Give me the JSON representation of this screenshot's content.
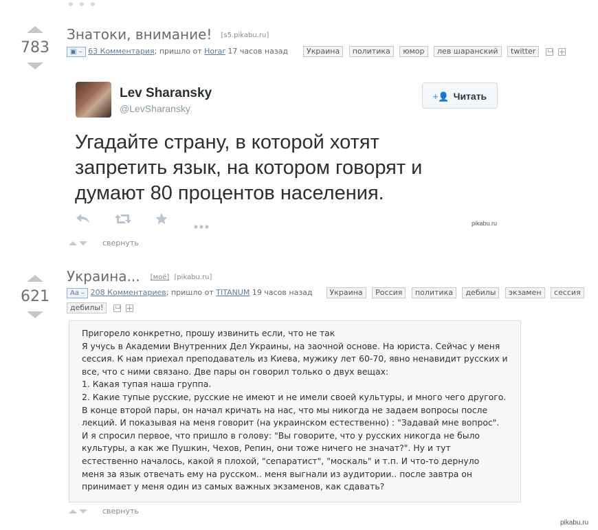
{
  "post1": {
    "score": "783",
    "title": "Знатоки, внимание!",
    "source": "[s5.pikabu.ru]",
    "badge": "▣ –",
    "comments": "63 Комментария",
    "from_prefix": "; пришло от ",
    "author": "Horar",
    "time": "17 часов назад",
    "tags": [
      "Украина",
      "политика",
      "юмор",
      "лев шаранский",
      "twitter"
    ],
    "tweet": {
      "name": "Lev Sharansky",
      "handle": "@LevSharansky",
      "follow": "Читать",
      "lines": [
        "Угадайте страну, в которой хотят",
        "запретить язык, на котором говорят и",
        "думают 80 процентов населения."
      ],
      "watermark": "pikabu.ru"
    },
    "collapse": "свернуть"
  },
  "post2": {
    "score": "621",
    "title": "Украина...",
    "source_mine": "[моё]",
    "source": "[pikabu.ru]",
    "badge": "Aa –",
    "comments": "208 Комментариев",
    "from_prefix": "; пришло от ",
    "author": "TITANUM",
    "time": "19 часов назад",
    "tags": [
      "Украина",
      "Россия",
      "политика",
      "дебилы",
      "экзамен",
      "сессия"
    ],
    "tags_row2": [
      "дебилы!"
    ],
    "story": [
      "Пригорело конкретно, прошу извинить если, что не так",
      "Я учусь в Академии Внутренних Дел Украины, на заочной основе. На юриста. Сейчас у меня",
      "сессия. К нам приехал преподаватель из Киева, мужику лет 60-70, явно ненавидит русских и",
      "все, что с ними связано. Две пары он говорил только о двух вещах:",
      "1. Какая тупая наша группа.",
      "2. Какие тупые русские, русские не имеют и не имели своей культуры, и много чего другого.",
      "В конце второй пары, он начал кричать на нас, что мы никогда не задаем вопросы после",
      "лекций. И показывая на меня говорит (на украинском естественно) : \"Задавай мне вопрос\".",
      "И я спросил первое, что пришло в голову: \"Вы говорите, что у русских никогда не было",
      "культуры, а как же Пушкин, Чехов, Репин, они тоже ничего не значат?\". Ну и тут",
      "естественно началось, какой я плохой, \"сепаратист\", \"москаль\" и т.п. И что-то дернуло",
      "меня за язык отвечать ему на русском.. меня выгнали из аудитории.. после завтра он",
      "принимает у меня один из самых важных экзаменов, как сдавать?"
    ],
    "collapse": "свернуть",
    "watermark": "pikabu.ru"
  },
  "icons": {
    "vote_up": "triangle-up-icon",
    "vote_down": "triangle-down-icon",
    "reply": "reply-icon",
    "retweet": "retweet-icon",
    "favorite": "star-icon",
    "more": "more-icon",
    "follow": "add-user-icon",
    "save": "save-icon",
    "add": "plus-icon"
  },
  "colors": {
    "link": "#5a7a9c",
    "badge": "#4c7aa6",
    "twitter_blue": "#55acee"
  }
}
